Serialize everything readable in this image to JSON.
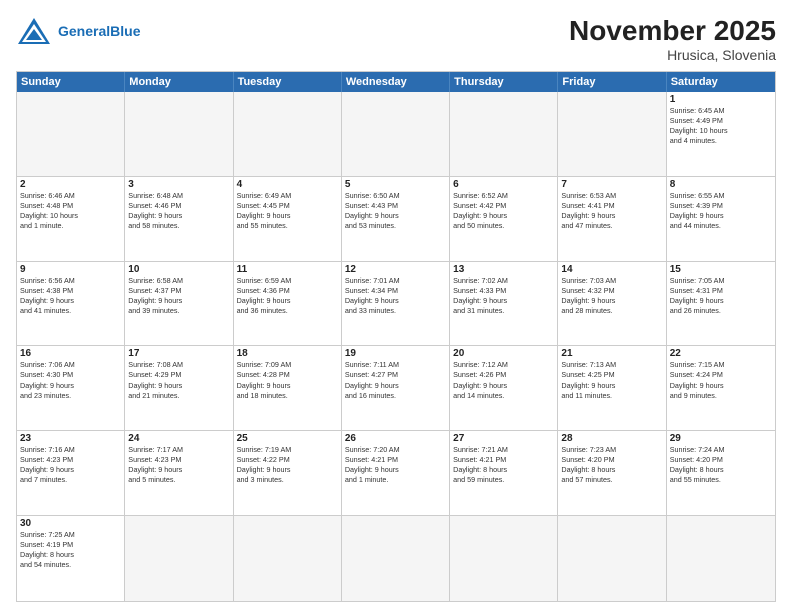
{
  "header": {
    "logo_general": "General",
    "logo_blue": "Blue",
    "month_title": "November 2025",
    "location": "Hrusica, Slovenia"
  },
  "days": [
    "Sunday",
    "Monday",
    "Tuesday",
    "Wednesday",
    "Thursday",
    "Friday",
    "Saturday"
  ],
  "cells": [
    {
      "date": "",
      "info": "",
      "empty": true
    },
    {
      "date": "",
      "info": "",
      "empty": true
    },
    {
      "date": "",
      "info": "",
      "empty": true
    },
    {
      "date": "",
      "info": "",
      "empty": true
    },
    {
      "date": "",
      "info": "",
      "empty": true
    },
    {
      "date": "",
      "info": "",
      "empty": true
    },
    {
      "date": "1",
      "info": "Sunrise: 6:45 AM\nSunset: 4:49 PM\nDaylight: 10 hours\nand 4 minutes."
    },
    {
      "date": "2",
      "info": "Sunrise: 6:46 AM\nSunset: 4:48 PM\nDaylight: 10 hours\nand 1 minute."
    },
    {
      "date": "3",
      "info": "Sunrise: 6:48 AM\nSunset: 4:46 PM\nDaylight: 9 hours\nand 58 minutes."
    },
    {
      "date": "4",
      "info": "Sunrise: 6:49 AM\nSunset: 4:45 PM\nDaylight: 9 hours\nand 55 minutes."
    },
    {
      "date": "5",
      "info": "Sunrise: 6:50 AM\nSunset: 4:43 PM\nDaylight: 9 hours\nand 53 minutes."
    },
    {
      "date": "6",
      "info": "Sunrise: 6:52 AM\nSunset: 4:42 PM\nDaylight: 9 hours\nand 50 minutes."
    },
    {
      "date": "7",
      "info": "Sunrise: 6:53 AM\nSunset: 4:41 PM\nDaylight: 9 hours\nand 47 minutes."
    },
    {
      "date": "8",
      "info": "Sunrise: 6:55 AM\nSunset: 4:39 PM\nDaylight: 9 hours\nand 44 minutes."
    },
    {
      "date": "9",
      "info": "Sunrise: 6:56 AM\nSunset: 4:38 PM\nDaylight: 9 hours\nand 41 minutes."
    },
    {
      "date": "10",
      "info": "Sunrise: 6:58 AM\nSunset: 4:37 PM\nDaylight: 9 hours\nand 39 minutes."
    },
    {
      "date": "11",
      "info": "Sunrise: 6:59 AM\nSunset: 4:36 PM\nDaylight: 9 hours\nand 36 minutes."
    },
    {
      "date": "12",
      "info": "Sunrise: 7:01 AM\nSunset: 4:34 PM\nDaylight: 9 hours\nand 33 minutes."
    },
    {
      "date": "13",
      "info": "Sunrise: 7:02 AM\nSunset: 4:33 PM\nDaylight: 9 hours\nand 31 minutes."
    },
    {
      "date": "14",
      "info": "Sunrise: 7:03 AM\nSunset: 4:32 PM\nDaylight: 9 hours\nand 28 minutes."
    },
    {
      "date": "15",
      "info": "Sunrise: 7:05 AM\nSunset: 4:31 PM\nDaylight: 9 hours\nand 26 minutes."
    },
    {
      "date": "16",
      "info": "Sunrise: 7:06 AM\nSunset: 4:30 PM\nDaylight: 9 hours\nand 23 minutes."
    },
    {
      "date": "17",
      "info": "Sunrise: 7:08 AM\nSunset: 4:29 PM\nDaylight: 9 hours\nand 21 minutes."
    },
    {
      "date": "18",
      "info": "Sunrise: 7:09 AM\nSunset: 4:28 PM\nDaylight: 9 hours\nand 18 minutes."
    },
    {
      "date": "19",
      "info": "Sunrise: 7:11 AM\nSunset: 4:27 PM\nDaylight: 9 hours\nand 16 minutes."
    },
    {
      "date": "20",
      "info": "Sunrise: 7:12 AM\nSunset: 4:26 PM\nDaylight: 9 hours\nand 14 minutes."
    },
    {
      "date": "21",
      "info": "Sunrise: 7:13 AM\nSunset: 4:25 PM\nDaylight: 9 hours\nand 11 minutes."
    },
    {
      "date": "22",
      "info": "Sunrise: 7:15 AM\nSunset: 4:24 PM\nDaylight: 9 hours\nand 9 minutes."
    },
    {
      "date": "23",
      "info": "Sunrise: 7:16 AM\nSunset: 4:23 PM\nDaylight: 9 hours\nand 7 minutes."
    },
    {
      "date": "24",
      "info": "Sunrise: 7:17 AM\nSunset: 4:23 PM\nDaylight: 9 hours\nand 5 minutes."
    },
    {
      "date": "25",
      "info": "Sunrise: 7:19 AM\nSunset: 4:22 PM\nDaylight: 9 hours\nand 3 minutes."
    },
    {
      "date": "26",
      "info": "Sunrise: 7:20 AM\nSunset: 4:21 PM\nDaylight: 9 hours\nand 1 minute."
    },
    {
      "date": "27",
      "info": "Sunrise: 7:21 AM\nSunset: 4:21 PM\nDaylight: 8 hours\nand 59 minutes."
    },
    {
      "date": "28",
      "info": "Sunrise: 7:23 AM\nSunset: 4:20 PM\nDaylight: 8 hours\nand 57 minutes."
    },
    {
      "date": "29",
      "info": "Sunrise: 7:24 AM\nSunset: 4:20 PM\nDaylight: 8 hours\nand 55 minutes."
    },
    {
      "date": "30",
      "info": "Sunrise: 7:25 AM\nSunset: 4:19 PM\nDaylight: 8 hours\nand 54 minutes."
    },
    {
      "date": "",
      "info": "",
      "empty": true
    },
    {
      "date": "",
      "info": "",
      "empty": true
    },
    {
      "date": "",
      "info": "",
      "empty": true
    },
    {
      "date": "",
      "info": "",
      "empty": true
    },
    {
      "date": "",
      "info": "",
      "empty": true
    },
    {
      "date": "",
      "info": "",
      "empty": true
    }
  ]
}
